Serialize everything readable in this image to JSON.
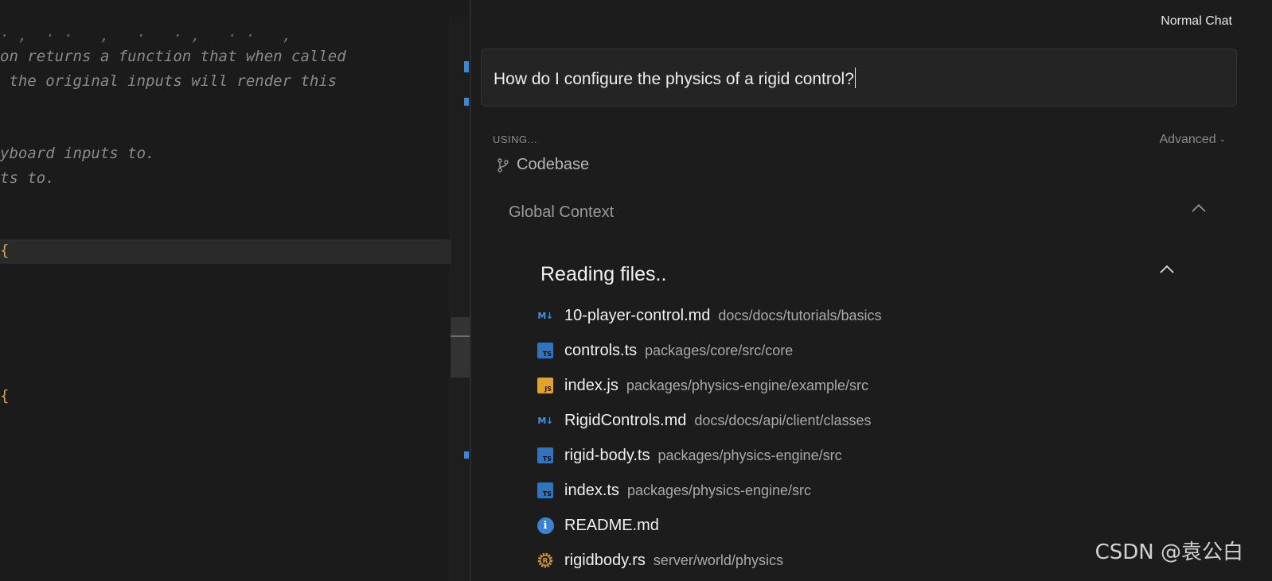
{
  "editor": {
    "lines": {
      "partial": "· ,  · ·   ,   ·   · ,   · ·   ,",
      "l1": "on returns a function that when called",
      "l2": " the original inputs will render this",
      "l3": "yboard inputs to.",
      "l4": "ts to."
    },
    "braces": [
      "{",
      "{"
    ]
  },
  "chat": {
    "mode": "Normal Chat",
    "query": "How do I configure the physics of a rigid control?",
    "using_label": "USING...",
    "advanced_label": "Advanced",
    "codebase_label": "Codebase",
    "global_context_label": "Global Context",
    "reading_label": "Reading files..",
    "files": [
      {
        "name": "10-player-control.md",
        "path": "docs/docs/tutorials/basics",
        "icon": "markdown-icon"
      },
      {
        "name": "controls.ts",
        "path": "packages/core/src/core",
        "icon": "typescript-icon"
      },
      {
        "name": "index.js",
        "path": "packages/physics-engine/example/src",
        "icon": "javascript-icon"
      },
      {
        "name": "RigidControls.md",
        "path": "docs/docs/api/client/classes",
        "icon": "markdown-icon"
      },
      {
        "name": "rigid-body.ts",
        "path": "packages/physics-engine/src",
        "icon": "typescript-icon"
      },
      {
        "name": "index.ts",
        "path": "packages/physics-engine/src",
        "icon": "typescript-icon"
      },
      {
        "name": "README.md",
        "path": "",
        "icon": "info-icon"
      },
      {
        "name": "rigidbody.rs",
        "path": "server/world/physics",
        "icon": "rust-icon"
      }
    ]
  },
  "icon_labels": {
    "md": "M↓",
    "ts": "TS",
    "js": "JS",
    "info": "i"
  },
  "watermark": "CSDN @袁公白",
  "colors": {
    "editor_bg": "#1b1b1b",
    "chat_bg": "#1c1c1c",
    "accent_blue": "#2f8ce0",
    "ts_blue": "#2f74c0",
    "js_yellow": "#e5a22a",
    "rust_orange": "#d99a2b"
  }
}
